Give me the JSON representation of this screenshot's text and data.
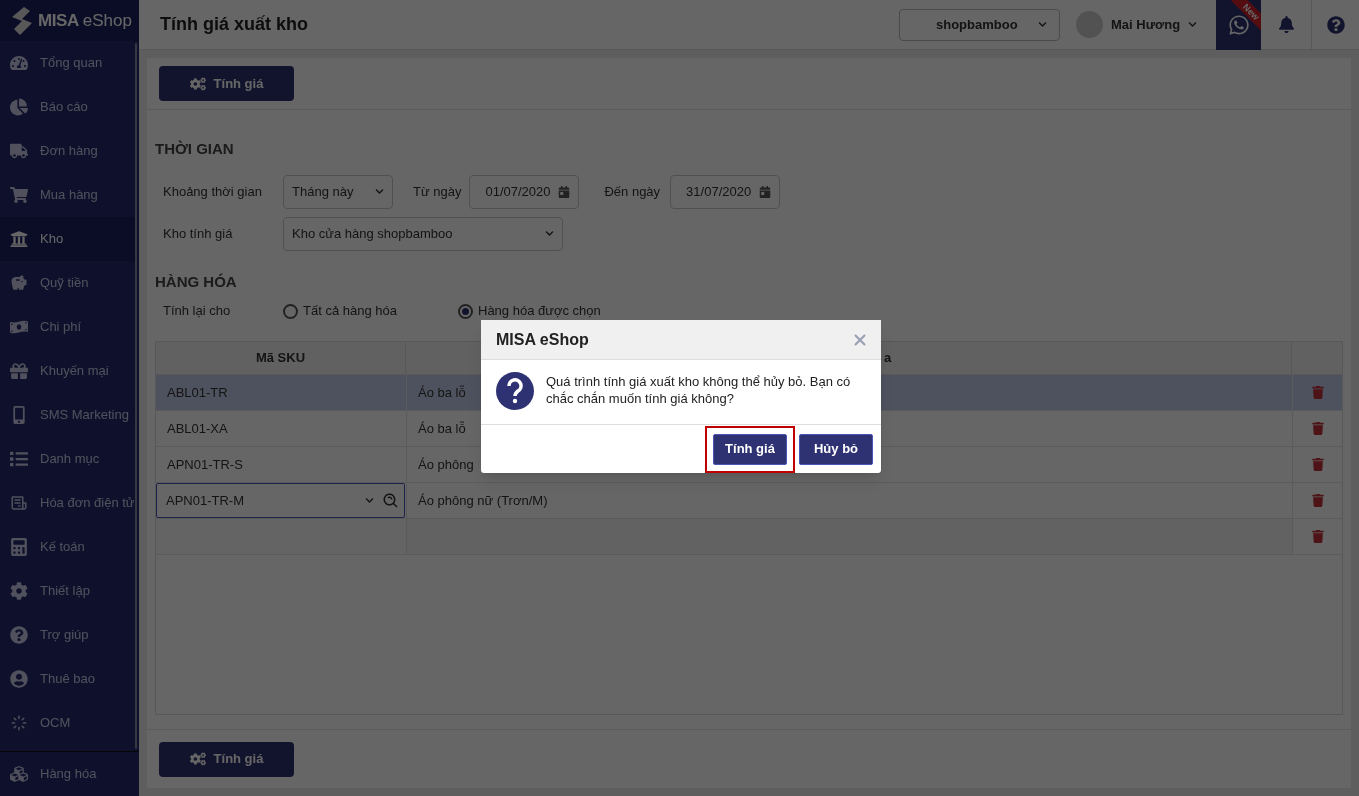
{
  "app": {
    "logo_mark": "MISA",
    "logo_suffix": "eShop"
  },
  "sidebar": {
    "items": [
      {
        "label": "Tổng quan",
        "selected": false
      },
      {
        "label": "Báo cáo",
        "selected": false
      },
      {
        "label": "Đơn hàng",
        "selected": false
      },
      {
        "label": "Mua hàng",
        "selected": false
      },
      {
        "label": "Kho",
        "selected": true
      },
      {
        "label": "Quỹ tiền",
        "selected": false
      },
      {
        "label": "Chi phí",
        "selected": false
      },
      {
        "label": "Khuyến mại",
        "selected": false
      },
      {
        "label": "SMS Marketing",
        "selected": false
      },
      {
        "label": "Danh mục",
        "selected": false
      },
      {
        "label": "Hóa đơn điện tử",
        "selected": false
      },
      {
        "label": "Kế toán",
        "selected": false
      },
      {
        "label": "Thiết lập",
        "selected": false
      },
      {
        "label": "Trợ giúp",
        "selected": false
      },
      {
        "label": "Thuê bao",
        "selected": false
      },
      {
        "label": "OCM",
        "selected": false
      }
    ],
    "footer_item": {
      "label": "Hàng hóa",
      "selected": false
    }
  },
  "header": {
    "title": "Tính giá xuất kho",
    "shop_select": "shopbamboo",
    "user": "Mai Hương",
    "new_badge": "New"
  },
  "toolbar": {
    "button": "Tính giá"
  },
  "time_section": {
    "heading": "THỜI GIAN",
    "period_label": "Khoảng thời gian",
    "period": "Tháng này",
    "from_label": "Từ ngày",
    "from": "01/07/2020",
    "to_label": "Đến ngày",
    "to": "31/07/2020",
    "warehouse_label": "Kho tính giá",
    "warehouse": "Kho cửa hàng shopbamboo"
  },
  "goods_section": {
    "heading": "HÀNG HÓA",
    "recalc_label": "Tính lại cho",
    "options": [
      {
        "label": "Tất cả hàng hóa",
        "selected": false
      },
      {
        "label": "Hàng hóa được chọn",
        "selected": true
      }
    ]
  },
  "table": {
    "columns": [
      "Mã SKU",
      "a"
    ],
    "rows": [
      {
        "kind": "text",
        "sku": "ABL01-TR",
        "name": "Áo ba lỗ",
        "selected": true
      },
      {
        "kind": "text",
        "sku": "ABL01-XA",
        "name": "Áo ba lỗ",
        "selected": false
      },
      {
        "kind": "text",
        "sku": "APN01-TR-S",
        "name": "Áo phông",
        "selected": false
      },
      {
        "kind": "combobox",
        "sku": "APN01-TR-M",
        "name": "Áo phông nữ (Trơn/M)",
        "selected": false
      },
      {
        "kind": "empty",
        "selected": false
      }
    ]
  },
  "footer": {
    "button": "Tính giá"
  },
  "dialog": {
    "title": "MISA eShop",
    "message": "Quá trình tính giá xuất kho không thể hủy bỏ. Bạn có chắc chắn muốn tính giá không?",
    "buttons": [
      {
        "label": "Tính giá",
        "highlighted": true
      },
      {
        "label": "Hủy bỏ",
        "highlighted": false
      }
    ]
  }
}
